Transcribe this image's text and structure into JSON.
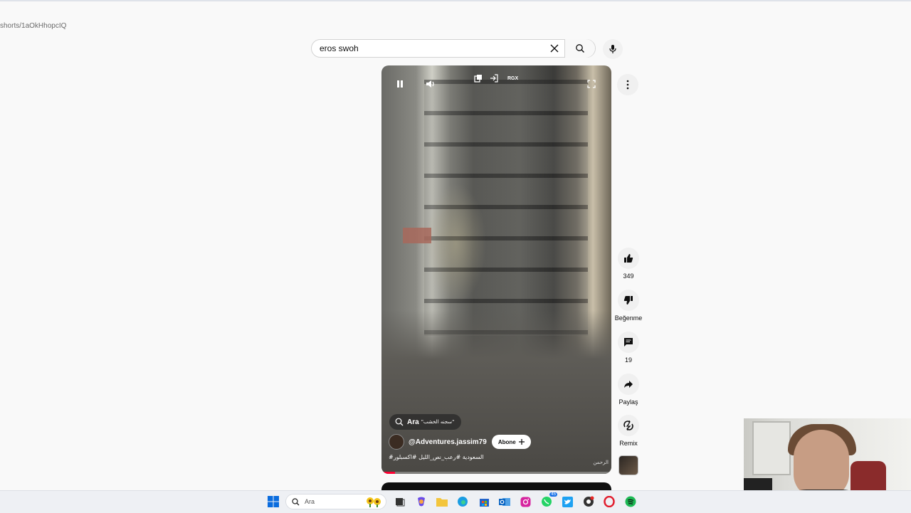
{
  "address": {
    "url_fragment": "shorts/1aOkHhopcIQ"
  },
  "search": {
    "query": "eros swoh"
  },
  "video": {
    "search_pill": {
      "label": "Ara",
      "query": "\"سجنه الخشب\""
    },
    "channel": {
      "handle": "@Adventures.jassim79",
      "subscribe_label": "Abone"
    },
    "hashtags": "#السعودية #رعب_نص_الليل #اكسبلور",
    "corner_text": "الرحمن",
    "overlay_label": "RGX",
    "progress": 0.06
  },
  "actions": {
    "likes": "349",
    "dislike_label": "Beğenme",
    "comments": "19",
    "share_label": "Paylaş",
    "remix_label": "Remix"
  },
  "taskbar": {
    "search_label": "Ara",
    "whatsapp_badge": "45"
  },
  "colors": {
    "accent": "#ff0033",
    "background": "#f9f9f9"
  }
}
